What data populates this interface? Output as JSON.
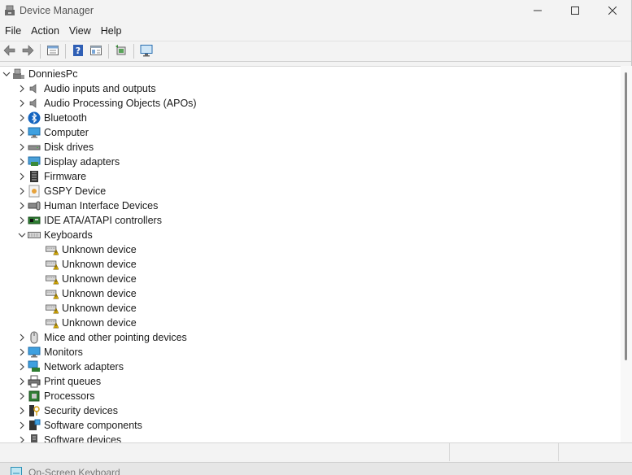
{
  "window": {
    "title": "Device Manager"
  },
  "menu": [
    "File",
    "Action",
    "View",
    "Help"
  ],
  "toolbar": [
    {
      "name": "back-arrow-icon"
    },
    {
      "name": "forward-arrow-icon"
    },
    {
      "name": "sep"
    },
    {
      "name": "properties-icon"
    },
    {
      "name": "sep"
    },
    {
      "name": "help-icon"
    },
    {
      "name": "view-list-icon"
    },
    {
      "name": "sep"
    },
    {
      "name": "update-driver-icon"
    },
    {
      "name": "sep"
    },
    {
      "name": "scan-hardware-icon"
    }
  ],
  "tree": {
    "root": "DonniesPc",
    "categories": [
      {
        "label": "Audio inputs and outputs",
        "icon": "speaker-icon",
        "expanded": false
      },
      {
        "label": "Audio Processing Objects (APOs)",
        "icon": "speaker-icon",
        "expanded": false
      },
      {
        "label": "Bluetooth",
        "icon": "bluetooth-icon",
        "expanded": false
      },
      {
        "label": "Computer",
        "icon": "computer-icon",
        "expanded": false
      },
      {
        "label": "Disk drives",
        "icon": "disk-drive-icon",
        "expanded": false
      },
      {
        "label": "Display adapters",
        "icon": "display-adapter-icon",
        "expanded": false
      },
      {
        "label": "Firmware",
        "icon": "firmware-icon",
        "expanded": false
      },
      {
        "label": "GSPY Device",
        "icon": "gspy-device-icon",
        "expanded": false
      },
      {
        "label": "Human Interface Devices",
        "icon": "hid-icon",
        "expanded": false
      },
      {
        "label": "IDE ATA/ATAPI controllers",
        "icon": "ide-controller-icon",
        "expanded": false
      },
      {
        "label": "Keyboards",
        "icon": "keyboard-icon",
        "expanded": true,
        "children": [
          "Unknown device",
          "Unknown device",
          "Unknown device",
          "Unknown device",
          "Unknown device",
          "Unknown device"
        ]
      },
      {
        "label": "Mice and other pointing devices",
        "icon": "mouse-icon",
        "expanded": false
      },
      {
        "label": "Monitors",
        "icon": "monitor-icon",
        "expanded": false
      },
      {
        "label": "Network adapters",
        "icon": "network-adapter-icon",
        "expanded": false
      },
      {
        "label": "Print queues",
        "icon": "printer-icon",
        "expanded": false
      },
      {
        "label": "Processors",
        "icon": "processor-icon",
        "expanded": false
      },
      {
        "label": "Security devices",
        "icon": "security-device-icon",
        "expanded": false
      },
      {
        "label": "Software components",
        "icon": "software-component-icon",
        "expanded": false
      },
      {
        "label": "Software devices",
        "icon": "software-device-icon",
        "expanded": false
      }
    ]
  },
  "taskbar": {
    "label": "On-Screen Keyboard"
  }
}
